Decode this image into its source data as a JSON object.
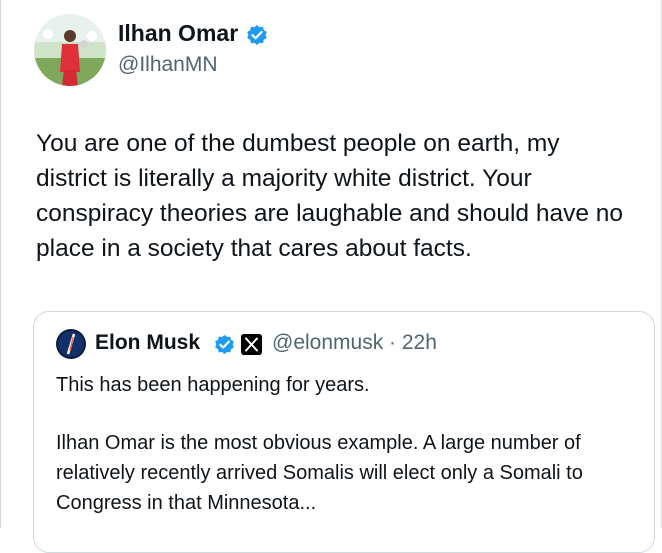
{
  "tweet": {
    "author": {
      "name": "Ilhan Omar",
      "handle": "@IlhanMN",
      "avatar_icon": "profile-photo",
      "verified_color": "#1d9bf0"
    },
    "text": "You are one of the dumbest people on earth, my district is literally a majority white district. Your conspiracy theories are laughable and should have no place in a society that cares about facts."
  },
  "quoted_tweet": {
    "author": {
      "name": "Elon Musk",
      "handle_time": "@elonmusk · 22h",
      "avatar_icon": "profile-photo",
      "badge_icon": "x-logo-icon"
    },
    "paragraph1": "This has been happening for years.",
    "paragraph2": "Ilhan Omar is the most obvious example. A large number of relatively recently arrived Somalis will elect only a Somali to Congress in that Minnesota..."
  }
}
